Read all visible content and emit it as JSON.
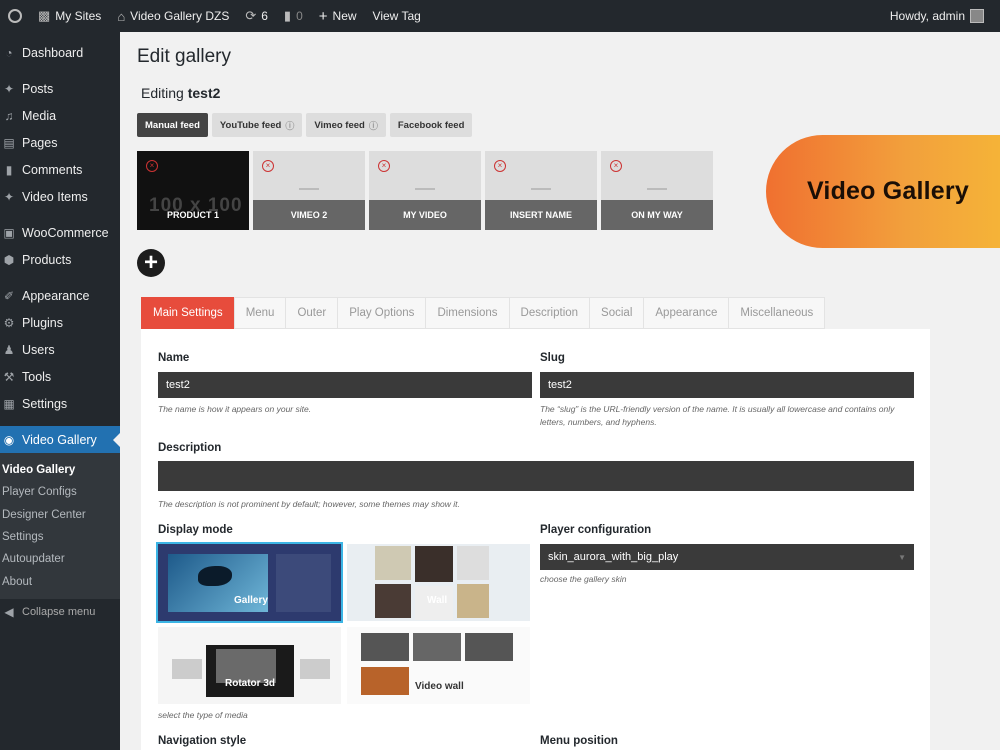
{
  "adminbar": {
    "my_sites": "My Sites",
    "site_name": "Video Gallery DZS",
    "updates_count": "6",
    "comments_count": "0",
    "new_label": "New",
    "view_tag": "View Tag",
    "howdy": "Howdy, admin"
  },
  "sidebar": {
    "items": [
      {
        "label": "Dashboard",
        "icon": "dashboard-icon"
      },
      {
        "label": "Posts",
        "icon": "pin-icon"
      },
      {
        "label": "Media",
        "icon": "media-icon"
      },
      {
        "label": "Pages",
        "icon": "pages-icon"
      },
      {
        "label": "Comments",
        "icon": "comment-icon"
      },
      {
        "label": "Video Items",
        "icon": "pin-icon"
      },
      {
        "label": "WooCommerce",
        "icon": "woo-icon"
      },
      {
        "label": "Products",
        "icon": "box-icon"
      },
      {
        "label": "Appearance",
        "icon": "brush-icon"
      },
      {
        "label": "Plugins",
        "icon": "plug-icon"
      },
      {
        "label": "Users",
        "icon": "user-icon"
      },
      {
        "label": "Tools",
        "icon": "wrench-icon"
      },
      {
        "label": "Settings",
        "icon": "settings-icon"
      },
      {
        "label": "Video Gallery",
        "icon": "video-gallery-icon"
      }
    ],
    "submenu": [
      "Video Gallery",
      "Player Configs",
      "Designer Center",
      "Settings",
      "Autoupdater",
      "About"
    ],
    "collapse": "Collapse menu"
  },
  "page": {
    "title": "Edit gallery",
    "editing_prefix": "Editing",
    "editing_name": "test2"
  },
  "feed_tabs": [
    "Manual feed",
    "YouTube feed",
    "Vimeo feed",
    "Facebook feed"
  ],
  "thumbs": [
    {
      "label": "PRODUCT 1",
      "placeholder": "100 x 100"
    },
    {
      "label": "VIMEO 2"
    },
    {
      "label": "MY VIDEO"
    },
    {
      "label": "INSERT NAME"
    },
    {
      "label": "ON MY WAY"
    }
  ],
  "tabs": [
    "Main Settings",
    "Menu",
    "Outer",
    "Play Options",
    "Dimensions",
    "Description",
    "Social",
    "Appearance",
    "Miscellaneous"
  ],
  "form": {
    "name_label": "Name",
    "name_value": "test2",
    "name_hint": "The name is how it appears on your site.",
    "slug_label": "Slug",
    "slug_value": "test2",
    "slug_hint": "The “slug” is the URL-friendly version of the name. It is usually all lowercase and contains only letters, numbers, and hyphens.",
    "description_label": "Description",
    "description_hint": "The description is not prominent by default; however, some themes may show it.",
    "display_mode_label": "Display mode",
    "display_mode_hint": "select the type of media",
    "modes": [
      "Gallery",
      "Wall",
      "Rotator 3d",
      "Video wall"
    ],
    "player_config_label": "Player configuration",
    "player_config_value": "skin_aurora_with_big_play",
    "player_config_hint": "choose the gallery skin",
    "navigation_style_label": "Navigation style",
    "menu_position_label": "Menu position"
  },
  "banner": {
    "text": "Video Gallery",
    "color_start": "#f07030",
    "color_end": "#f5b338"
  },
  "colors": {
    "active_tab": "#e74c3c",
    "admin_dark": "#23282d",
    "menu_active": "#2271b1"
  }
}
